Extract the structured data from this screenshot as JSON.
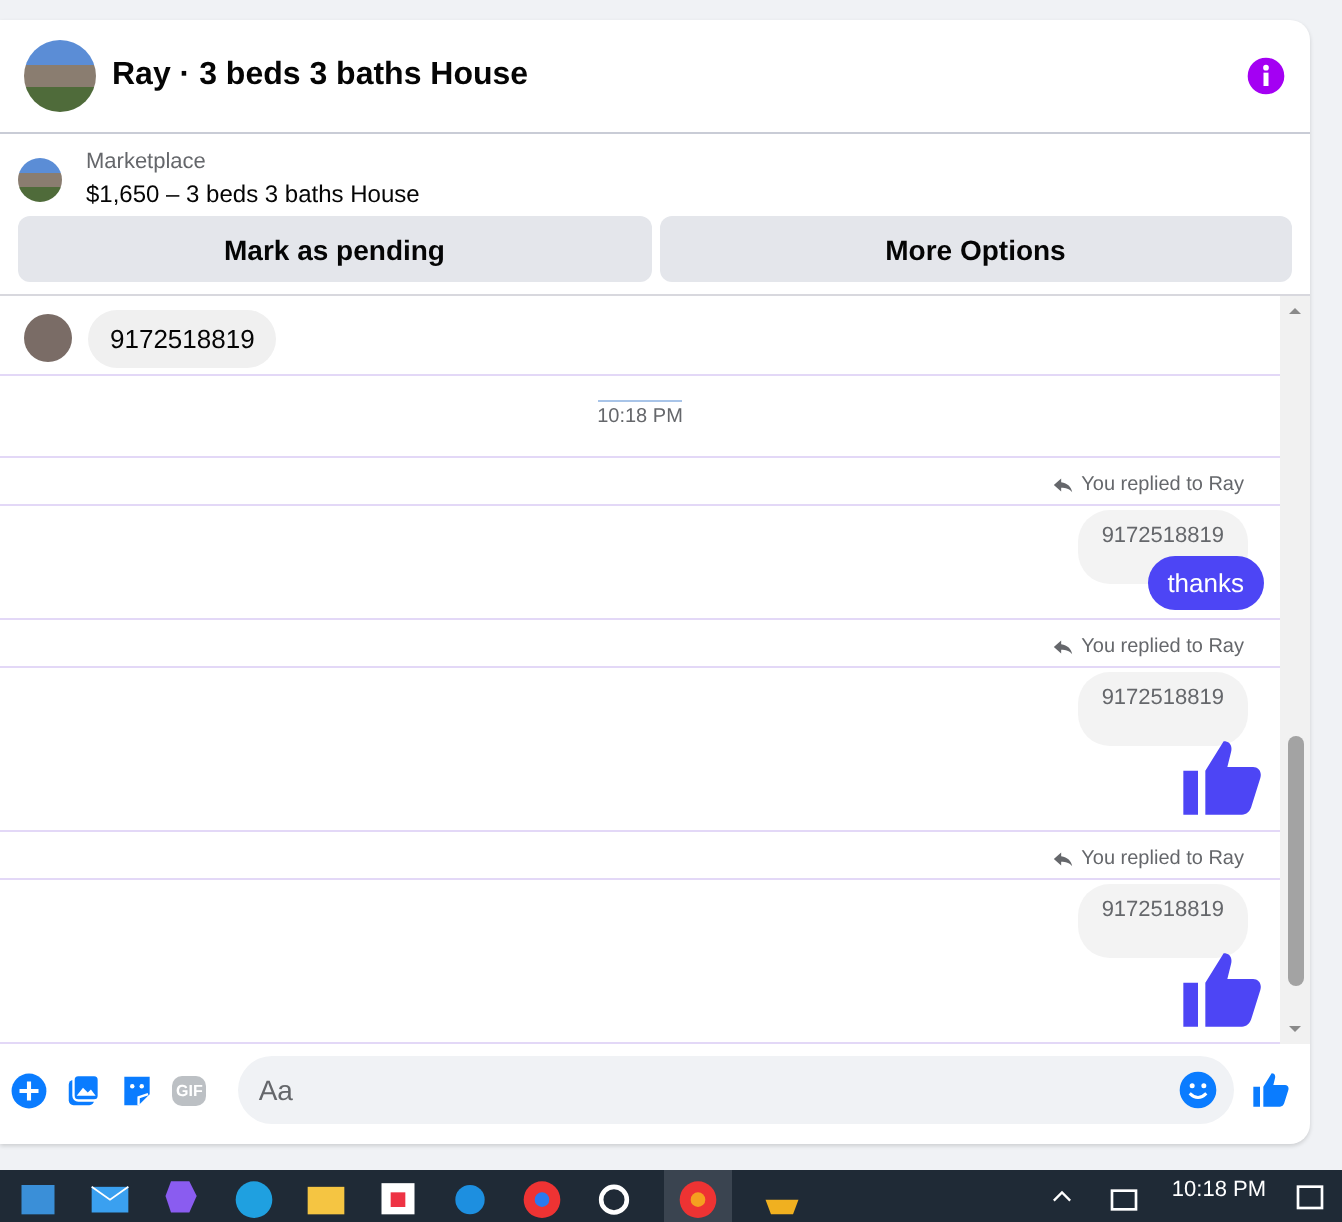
{
  "header": {
    "title": "Ray · 3 beds 3 baths House"
  },
  "listing": {
    "source": "Marketplace",
    "summary": "$1,650 – 3 beds 3 baths House",
    "buttons": [
      "Mark as pending",
      "More Options"
    ]
  },
  "messages": [
    {
      "kind": "incoming",
      "text": "9172518819"
    },
    {
      "kind": "timestamp",
      "text": "10:18 PM"
    },
    {
      "kind": "reply_note",
      "text": "You replied to Ray"
    },
    {
      "kind": "outgoing",
      "quote": "9172518819",
      "reply": {
        "kind": "text",
        "text": "thanks"
      }
    },
    {
      "kind": "reply_note",
      "text": "You replied to Ray"
    },
    {
      "kind": "outgoing",
      "quote": "9172518819",
      "reply": {
        "kind": "like"
      }
    },
    {
      "kind": "reply_note",
      "text": "You replied to Ray"
    },
    {
      "kind": "outgoing",
      "quote": "9172518819",
      "reply": {
        "kind": "like"
      }
    }
  ],
  "composer": {
    "gif_label": "GIF",
    "placeholder": "Aa"
  },
  "taskbar": {
    "time": "10:18 PM"
  }
}
